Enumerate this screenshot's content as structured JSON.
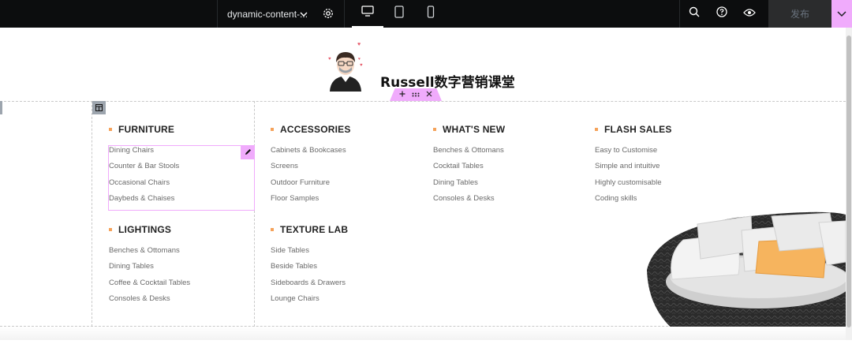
{
  "topbar": {
    "document_name": "dynamic-content-...",
    "publish_label": "发布"
  },
  "header": {
    "site_title": "Russell数字营销课堂"
  },
  "menu": {
    "groups": [
      {
        "title": "FURNITURE",
        "links": [
          "Dining Chairs",
          "Counter & Bar Stools",
          "Occasional Chairs",
          "Daybeds & Chaises"
        ]
      },
      {
        "title": "ACCESSORIES",
        "links": [
          "Cabinets & Bookcases",
          "Screens",
          "Outdoor Furniture",
          "Floor Samples"
        ]
      },
      {
        "title": "WHAT'S NEW",
        "links": [
          "Benches & Ottomans",
          "Cocktail Tables",
          "Dining Tables",
          "Consoles & Desks"
        ]
      },
      {
        "title": "FLASH SALES",
        "links": [
          "Easy to Customise",
          "Simple and intuitive",
          "Highly customisable",
          "Coding skills"
        ]
      },
      {
        "title": "LIGHTINGS",
        "links": [
          "Benches & Ottomans",
          "Dining Tables",
          "Coffee & Cocktail Tables",
          "Consoles & Desks"
        ]
      },
      {
        "title": "TEXTURE LAB",
        "links": [
          "Side Tables",
          "Beside Tables",
          "Sideboards & Drawers",
          "Lounge Chairs"
        ]
      }
    ]
  },
  "colors": {
    "accent": "#f0abfc",
    "bullet": "#f5a25a",
    "topbar_bg": "#0c0d0e"
  },
  "icons": [
    "chevron-down-icon",
    "gear-icon",
    "desktop-icon",
    "tablet-icon",
    "mobile-icon",
    "search-icon",
    "help-icon",
    "eye-icon",
    "plus-icon",
    "drag-icon",
    "close-icon",
    "column-icon",
    "pencil-icon"
  ]
}
